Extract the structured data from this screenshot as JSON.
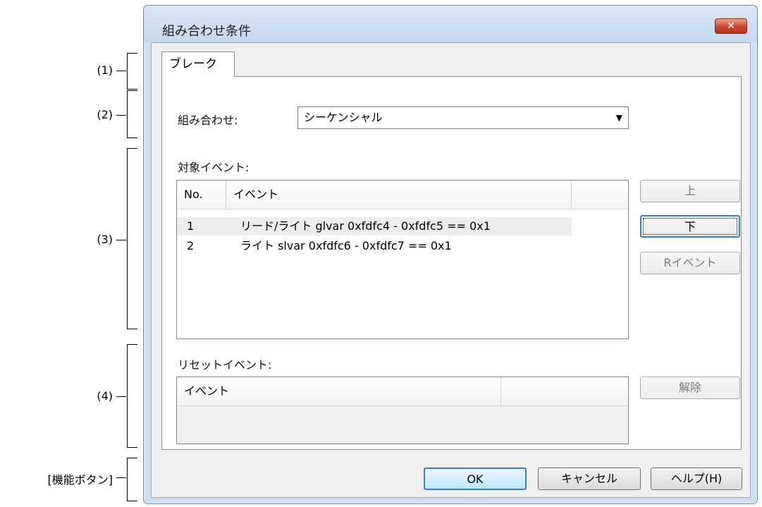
{
  "callouts": [
    {
      "label": "(1)"
    },
    {
      "label": "(2)"
    },
    {
      "label": "(3)"
    },
    {
      "label": "(4)"
    },
    {
      "label": "[機能ボタン]"
    }
  ],
  "window": {
    "title": "組み合わせ条件",
    "close_symbol": "✕"
  },
  "tab": {
    "label": "ブレーク"
  },
  "combination": {
    "label": "組み合わせ:",
    "value": "シーケンシャル"
  },
  "target_events": {
    "label": "対象イベント:",
    "columns": [
      "No.",
      "イベント"
    ],
    "rows": [
      {
        "no": "1",
        "event": "リード/ライト glvar 0xfdfc4 - 0xfdfc5 == 0x1"
      },
      {
        "no": "2",
        "event": "ライト slvar 0xfdfc6 - 0xfdfc7 == 0x1"
      }
    ]
  },
  "side_buttons": {
    "up": "上",
    "down": "下",
    "r_event": "Rイベント"
  },
  "reset_events": {
    "label": "リセットイベント:",
    "columns": [
      "イベント"
    ],
    "release_button": "解除"
  },
  "function_buttons": {
    "ok": "OK",
    "cancel": "キャンセル",
    "help": "ヘルプ(H)"
  }
}
